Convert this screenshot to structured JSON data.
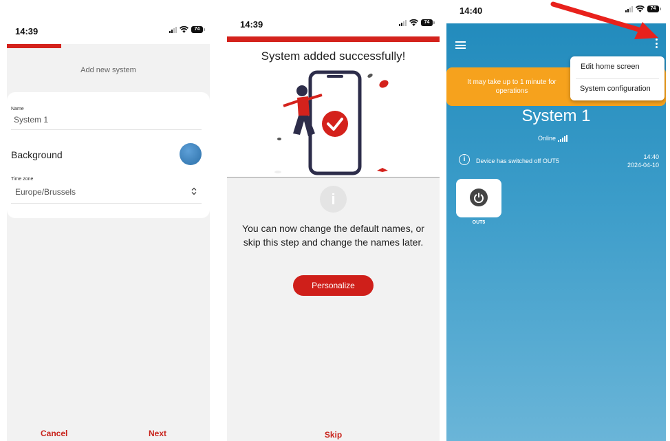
{
  "screen1": {
    "time": "14:39",
    "battery": "74",
    "heading": "Add new system",
    "name_label": "Name",
    "name_value": "System 1",
    "background_label": "Background",
    "background_color": "#3f86c2",
    "timezone_label": "Time zone",
    "timezone_value": "Europe/Brussels",
    "cancel": "Cancel",
    "next": "Next",
    "accent": "#d4221c"
  },
  "screen2": {
    "time": "14:39",
    "battery": "74",
    "title": "System added successfully!",
    "info_icon": "i",
    "message": "You can now change the default names, or skip this step and change the names later.",
    "personalize": "Personalize",
    "skip": "Skip"
  },
  "screen3": {
    "time": "14:40",
    "battery": "74",
    "banner": "It may take up to 1 minute for operations",
    "menu": [
      "Edit home screen",
      "System configuration"
    ],
    "system_name": "System 1",
    "status": "Online",
    "event_text": "Device has switched off OUT5",
    "event_time": "14:40",
    "event_date": "2024-04-10",
    "tile_label": "OUT5",
    "banner_color": "#f6a21d"
  }
}
